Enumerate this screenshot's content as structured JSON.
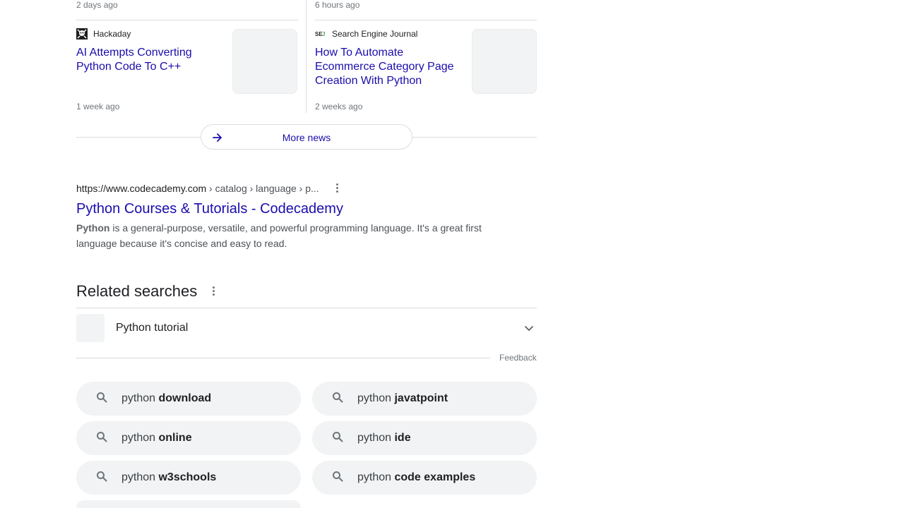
{
  "news": {
    "top_times": [
      "2 days ago",
      "6 hours ago"
    ],
    "cards": [
      {
        "source": "Hackaday",
        "icon": "hackaday-skull-icon",
        "title": "AI Attempts Converting Python Code To C++",
        "time": "1 week ago"
      },
      {
        "source": "Search Engine Journal",
        "icon": "sej-logo-icon",
        "title": "How To Automate Ecommerce Category Page Creation With Python",
        "time": "2 weeks ago"
      }
    ],
    "more_label": "More news"
  },
  "result": {
    "url_domain": "https://www.codecademy.com",
    "url_path": " › catalog › language › p...",
    "title": "Python Courses & Tutorials - Codecademy",
    "snippet_bold": "Python",
    "snippet_rest": " is a general-purpose, versatile, and powerful programming language. It's a great first language because it's concise and easy to read."
  },
  "related": {
    "heading": "Related searches",
    "accordion_item": "Python tutorial",
    "feedback": "Feedback",
    "chips": [
      {
        "prefix": "python ",
        "bold": "download"
      },
      {
        "prefix": "python ",
        "bold": "javatpoint"
      },
      {
        "prefix": "python ",
        "bold": "online"
      },
      {
        "prefix": "python ",
        "bold": "ide"
      },
      {
        "prefix": "python ",
        "bold": "w3schools"
      },
      {
        "prefix": "python ",
        "bold": "code examples"
      }
    ]
  },
  "colors": {
    "link": "#1a0dab",
    "chip_bg": "#f1f3f4",
    "divider": "#dadce0"
  }
}
